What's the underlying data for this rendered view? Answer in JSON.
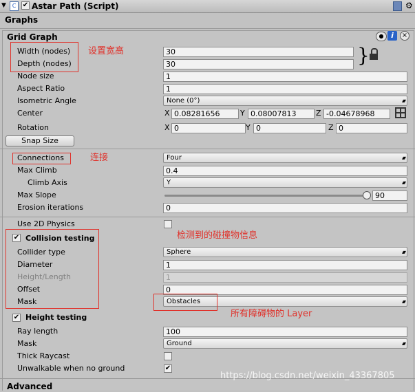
{
  "header": {
    "title": "Astar Path (Script)"
  },
  "graphs_label": "Graphs",
  "grid_graph": {
    "title": "Grid Graph",
    "width_label": "Width (nodes)",
    "width_value": "30",
    "depth_label": "Depth (nodes)",
    "depth_value": "30",
    "node_size_label": "Node size",
    "node_size_value": "1",
    "aspect_ratio_label": "Aspect Ratio",
    "aspect_ratio_value": "1",
    "iso_angle_label": "Isometric Angle",
    "iso_angle_value": "None (0°)",
    "center_label": "Center",
    "center_x": "0.08281656",
    "center_y": "0.08007813",
    "center_z": "-0.04678968",
    "rotation_label": "Rotation",
    "rotation_x": "0",
    "rotation_y": "0",
    "rotation_z": "0",
    "axis_x": "X",
    "axis_y": "Y",
    "axis_z": "Z",
    "snap_size_label": "Snap Size",
    "connections_label": "Connections",
    "connections_value": "Four",
    "max_climb_label": "Max Climb",
    "max_climb_value": "0.4",
    "climb_axis_label": "Climb Axis",
    "climb_axis_value": "Y",
    "max_slope_label": "Max Slope",
    "max_slope_value": "90",
    "erosion_label": "Erosion iterations",
    "erosion_value": "0"
  },
  "collision": {
    "use_2d_label": "Use 2D Physics",
    "use_2d_checked": false,
    "title": "Collision testing",
    "collider_type_label": "Collider type",
    "collider_type_value": "Sphere",
    "diameter_label": "Diameter",
    "diameter_value": "1",
    "height_label": "Height/Length",
    "height_value": "1",
    "offset_label": "Offset",
    "offset_value": "0",
    "mask_label": "Mask",
    "mask_value": "Obstacles"
  },
  "height_testing": {
    "title": "Height testing",
    "ray_length_label": "Ray length",
    "ray_length_value": "100",
    "mask_label": "Mask",
    "mask_value": "Ground",
    "thick_raycast_label": "Thick Raycast",
    "unwalkable_label": "Unwalkable when no ground"
  },
  "advanced_label": "Advanced",
  "annotations": {
    "size_note": "设置宽高",
    "connections_note": "连接",
    "collision_note": "检测到的碰撞物信息",
    "layer_note": "所有障碍物的 Layer"
  },
  "watermark": "https://blog.csdn.net/weixin_43367805",
  "check_glyph": "✔",
  "colors": {
    "annotation": "#e0312a",
    "background": "#c2c2c2",
    "info_icon": "#2a63c8"
  }
}
